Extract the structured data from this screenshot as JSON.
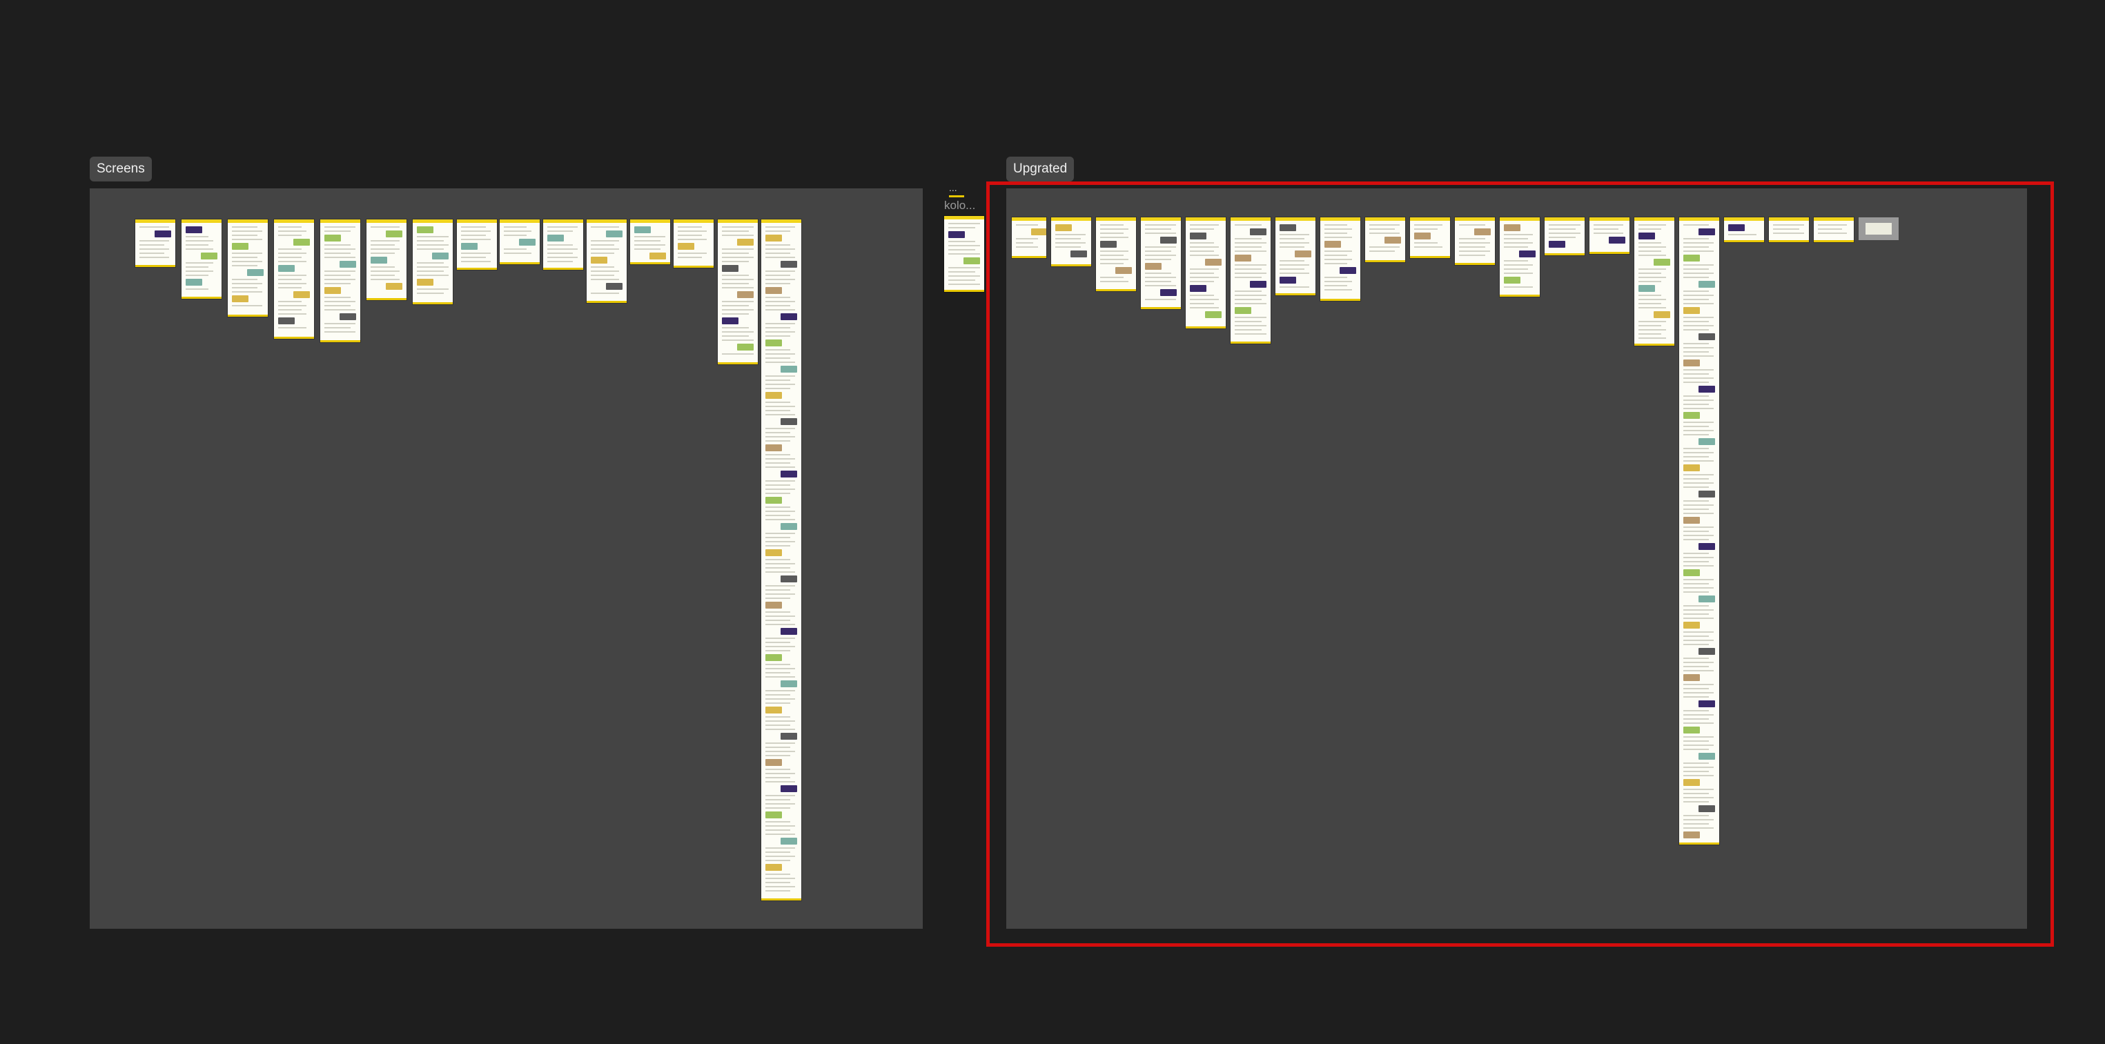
{
  "canvas": {
    "background": "#1e1e1e"
  },
  "frames": [
    {
      "label": "Screens",
      "fill": "#444444"
    },
    {
      "label": "Upgrated",
      "fill": "#444444"
    }
  ],
  "stray": {
    "ellipsis": "...",
    "title": "kolo..."
  },
  "selection": {
    "color": "#d40d0d"
  },
  "thumbnail_accent": "#e8c700"
}
